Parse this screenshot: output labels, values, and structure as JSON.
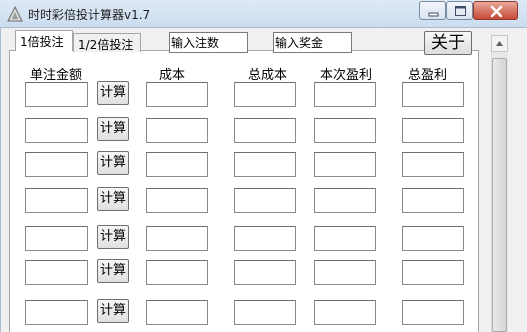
{
  "window": {
    "title": "时时彩倍投计算器v1.7"
  },
  "tabs": [
    {
      "label": "1倍投注",
      "active": true
    },
    {
      "label": "1/2倍投注",
      "active": false
    }
  ],
  "header": {
    "bet_count_value": "输入注数",
    "prize_value": "输入奖金",
    "about_label": "关于"
  },
  "columns": {
    "unit": "单注金额",
    "cost": "成本",
    "total_cost": "总成本",
    "profit": "本次盈利",
    "total_profit": "总盈利"
  },
  "rows": [
    {
      "calc_label": "计算",
      "unit": "",
      "cost": "",
      "total_cost": "",
      "profit": "",
      "total_profit": ""
    },
    {
      "calc_label": "计算",
      "unit": "",
      "cost": "",
      "total_cost": "",
      "profit": "",
      "total_profit": ""
    },
    {
      "calc_label": "计算",
      "unit": "",
      "cost": "",
      "total_cost": "",
      "profit": "",
      "total_profit": ""
    },
    {
      "calc_label": "计算",
      "unit": "",
      "cost": "",
      "total_cost": "",
      "profit": "",
      "total_profit": ""
    },
    {
      "calc_label": "计算",
      "unit": "",
      "cost": "",
      "total_cost": "",
      "profit": "",
      "total_profit": ""
    },
    {
      "calc_label": "计算",
      "unit": "",
      "cost": "",
      "total_cost": "",
      "profit": "",
      "total_profit": ""
    },
    {
      "calc_label": "计算",
      "unit": "",
      "cost": "",
      "total_cost": "",
      "profit": "",
      "total_profit": ""
    }
  ],
  "icons": {
    "app": "app-logo-icon",
    "minimize": "minimize-icon",
    "maximize": "maximize-icon",
    "close": "close-icon",
    "scroll_up": "chevron-up-icon"
  },
  "colors": {
    "titlebar": "#cbdcf0",
    "close_button": "#c74a36",
    "panel": "#ffffff"
  }
}
